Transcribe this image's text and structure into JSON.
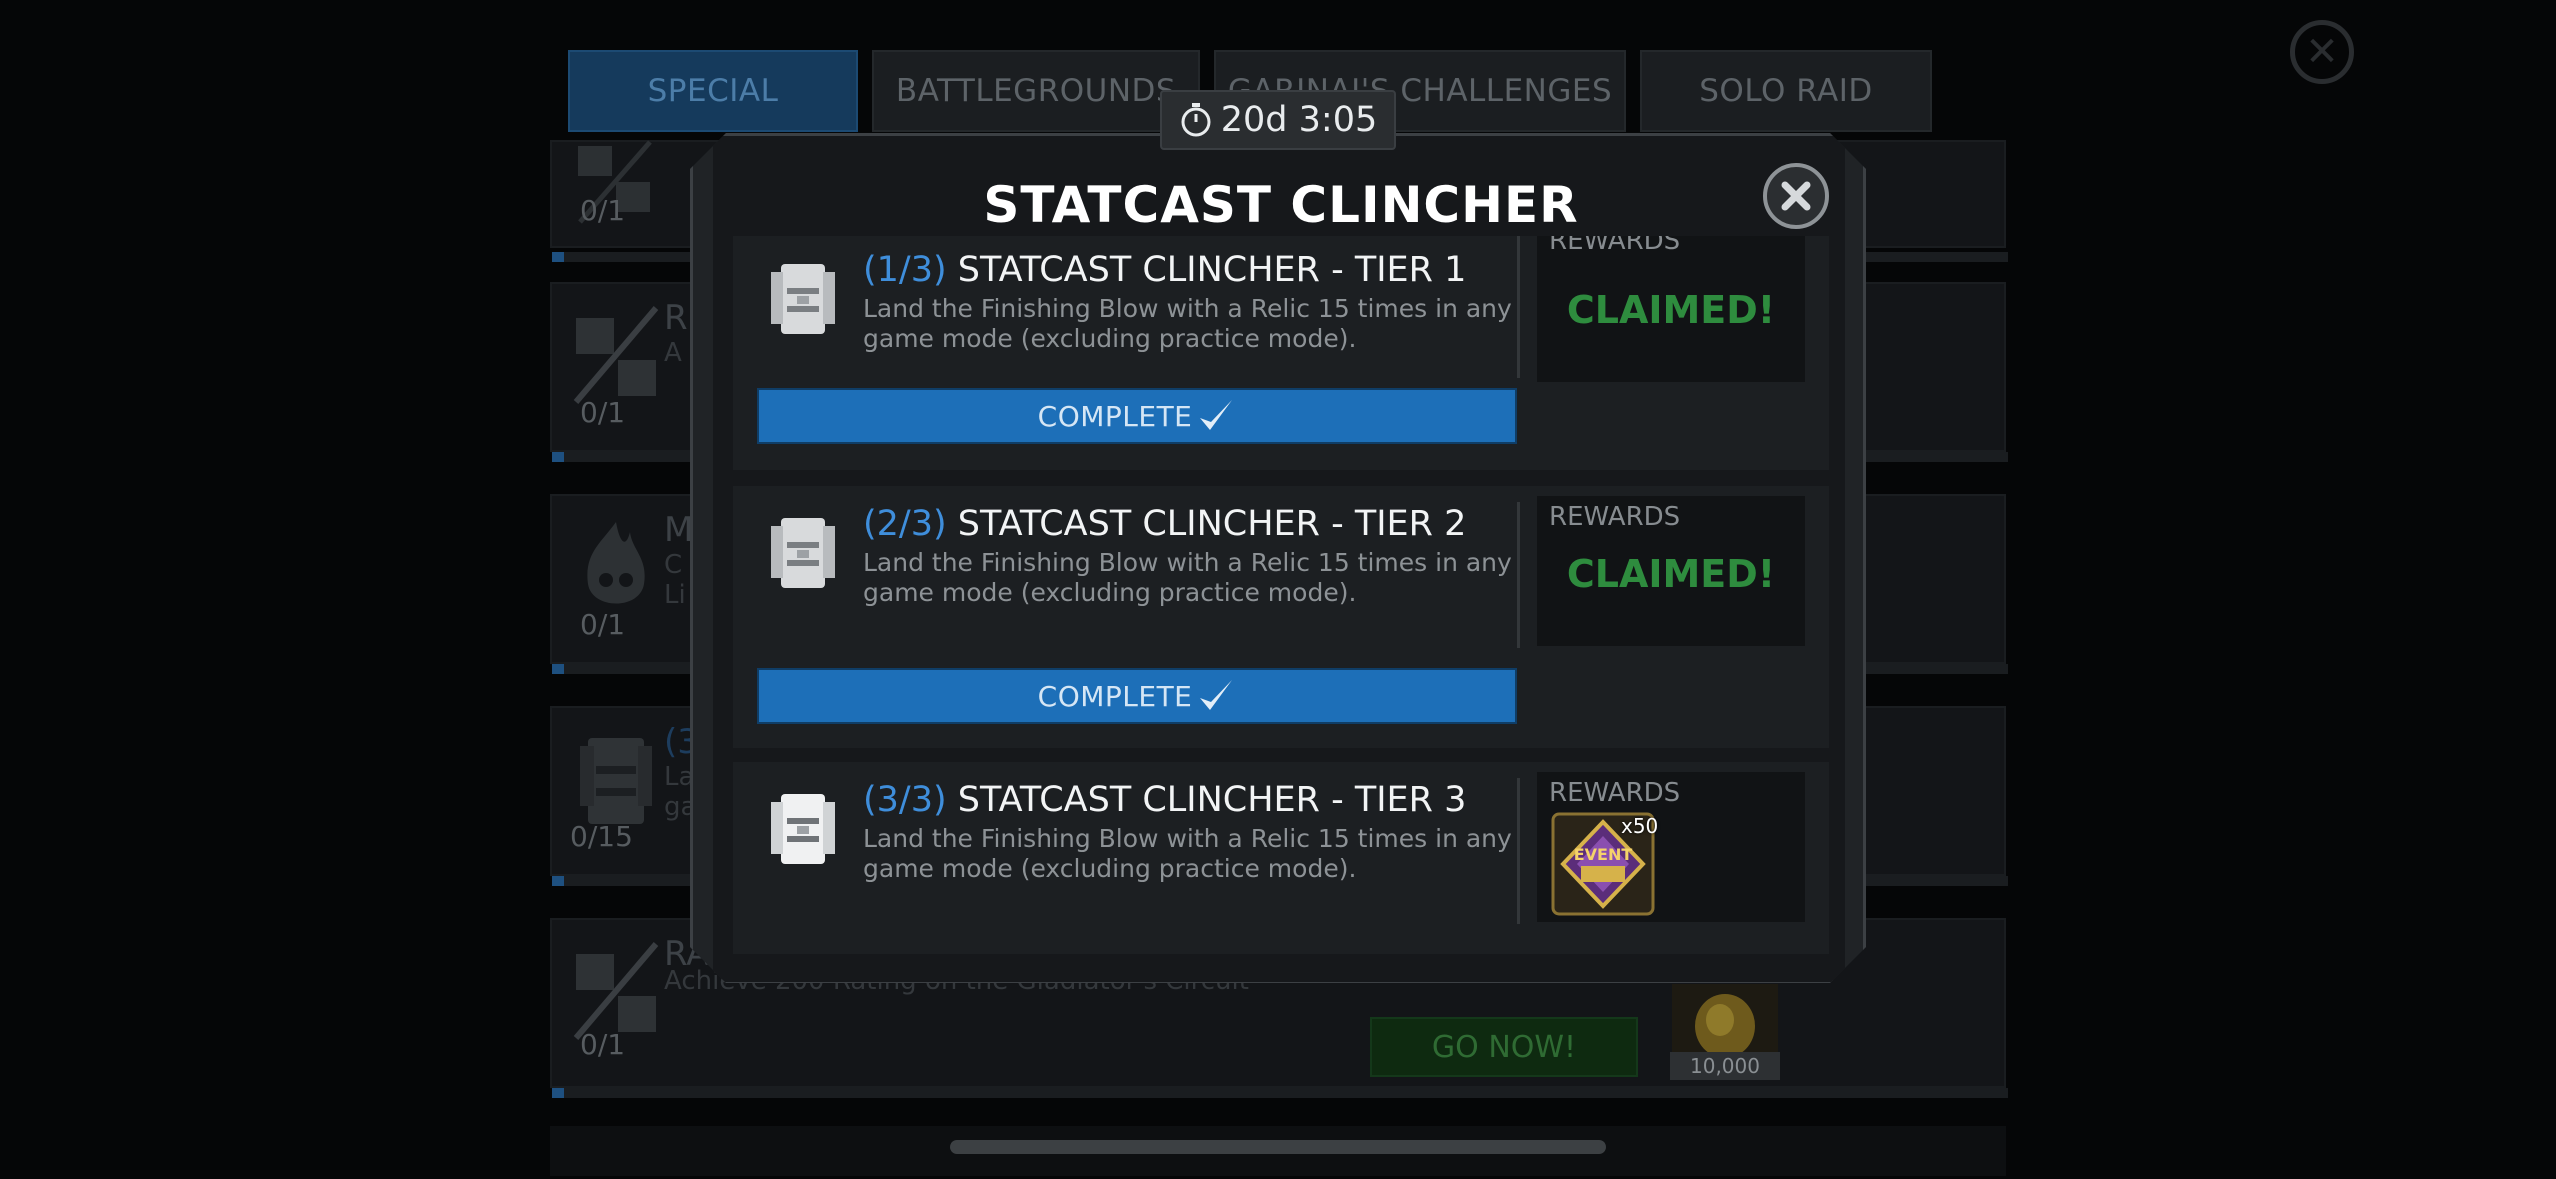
{
  "tabs": [
    {
      "label": "SPECIAL",
      "active": true
    },
    {
      "label": "BATTLEGROUNDS",
      "active": false
    },
    {
      "label": "GARINAI'S CHALLENGES",
      "active": false
    },
    {
      "label": "SOLO RAID",
      "active": false
    }
  ],
  "background_rows": [
    {
      "title": "",
      "desc": "",
      "count": "0/1"
    },
    {
      "title": "R",
      "desc": "A",
      "count": "0/1"
    },
    {
      "title": "M",
      "desc": "C\nLi",
      "count": "0/1"
    },
    {
      "title": "(3",
      "desc": "La\nga",
      "count": "0/15"
    },
    {
      "title": "RA",
      "desc": "Achieve 200 Rating on the Gladiator's Circuit",
      "count": "0/1"
    }
  ],
  "background_go_now": "GO NOW!",
  "background_reward_qty": "10,000",
  "timer": {
    "icon": "stopwatch-icon",
    "text": "20d 3:05"
  },
  "modal": {
    "title": "STATCAST CLINCHER",
    "tiers": [
      {
        "step": "(1/3)",
        "name": "STATCAST CLINCHER - TIER 1",
        "desc": "Land the Finishing Blow with a Relic 15 times in any game mode (excluding practice mode).",
        "rewards_label": "REWARDS",
        "status": "CLAIMED!",
        "button": "COMPLETE"
      },
      {
        "step": "(2/3)",
        "name": "STATCAST CLINCHER - TIER 2",
        "desc": "Land the Finishing Blow with a Relic 15 times in any game mode (excluding practice mode).",
        "rewards_label": "REWARDS",
        "status": "CLAIMED!",
        "button": "COMPLETE"
      },
      {
        "step": "(3/3)",
        "name": "STATCAST CLINCHER - TIER 3",
        "desc": "Land the Finishing Blow with a Relic 15 times in any game mode (excluding practice mode).",
        "rewards_label": "REWARDS",
        "reward_item": {
          "name": "event-badge-icon",
          "qty": "x50",
          "art_text": "EVENT"
        }
      }
    ]
  },
  "colors": {
    "accent_blue": "#1d6fb8",
    "step_blue": "#3f8edb",
    "claimed_green": "#2e8c3e",
    "modal_bg": "#16181b"
  }
}
